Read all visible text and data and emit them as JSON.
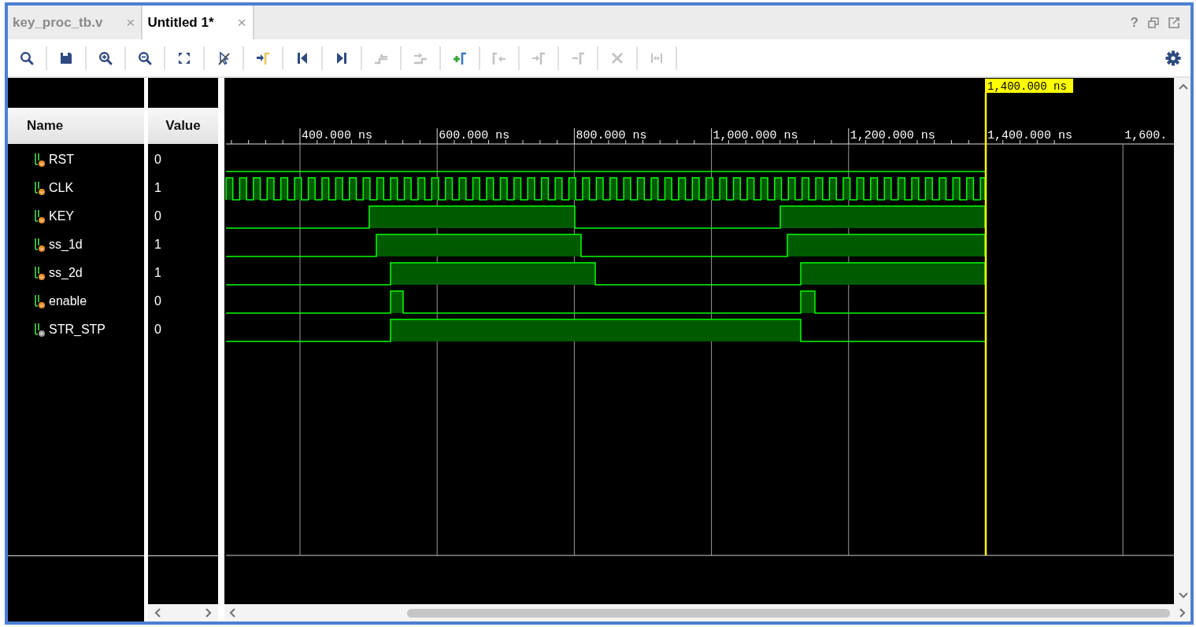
{
  "tabs": [
    {
      "label": "key_proc_tb.v",
      "close": "×",
      "selected": false
    },
    {
      "label": "Untitled 1*",
      "close": "×",
      "selected": true
    }
  ],
  "help": "?",
  "toolbar": [
    {
      "kind": "search",
      "disabled": false
    },
    {
      "kind": "save",
      "disabled": false
    },
    {
      "kind": "zoom-in",
      "disabled": false
    },
    {
      "kind": "zoom-out",
      "disabled": false
    },
    {
      "kind": "zoom-fit",
      "disabled": false
    },
    {
      "kind": "snap",
      "disabled": false
    },
    {
      "kind": "go-to-cursor",
      "disabled": false
    },
    {
      "kind": "go-to-start",
      "disabled": false
    },
    {
      "kind": "go-to-end",
      "disabled": false
    },
    {
      "kind": "previous-transition",
      "disabled": true
    },
    {
      "kind": "next-transition",
      "disabled": true
    },
    {
      "kind": "add-marker",
      "disabled": false
    },
    {
      "kind": "previous-marker",
      "disabled": true
    },
    {
      "kind": "next-marker",
      "disabled": true
    },
    {
      "kind": "swap-cursors",
      "disabled": true
    },
    {
      "kind": "delete",
      "disabled": true
    },
    {
      "kind": "expand",
      "disabled": true
    }
  ],
  "columns": [
    "Name",
    "Value"
  ],
  "ruler": [
    "400.000 ns",
    "600.000 ns",
    "800.000 ns",
    "1,000.000 ns",
    "1,200.000 ns",
    "1,400.000 ns",
    "1,600."
  ],
  "cursor": {
    "label": "1,400.000 ns"
  },
  "signals": [
    {
      "name": "RST",
      "value": "0",
      "kind": "wire"
    },
    {
      "name": "CLK",
      "value": "1",
      "kind": "wire"
    },
    {
      "name": "KEY",
      "value": "0",
      "kind": "wire"
    },
    {
      "name": "ss_1d",
      "value": "1",
      "kind": "wire"
    },
    {
      "name": "ss_2d",
      "value": "1",
      "kind": "wire"
    },
    {
      "name": "enable",
      "value": "0",
      "kind": "wire"
    },
    {
      "name": "STR_STP",
      "value": "0",
      "kind": "reg"
    }
  ]
}
